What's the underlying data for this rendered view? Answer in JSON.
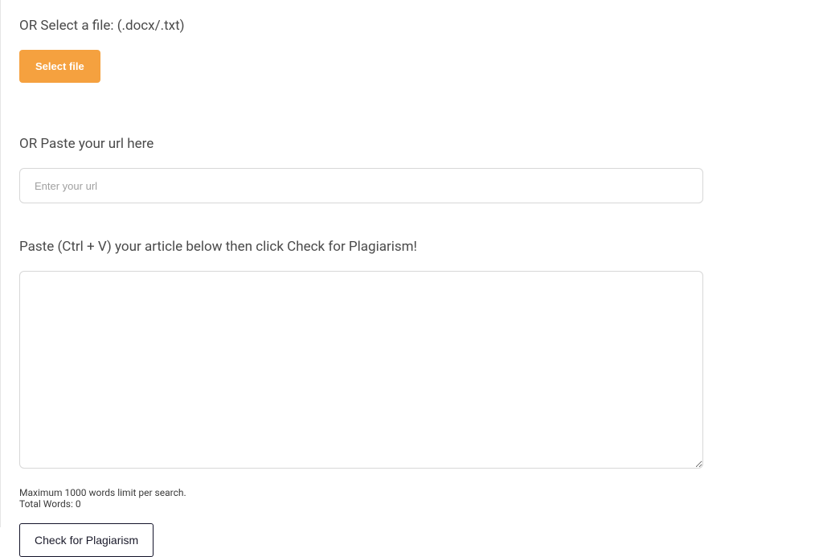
{
  "file_section": {
    "label": "OR Select a file: (.docx/.txt)",
    "button_label": "Select file"
  },
  "url_section": {
    "label": "OR Paste your url here",
    "placeholder": "Enter your url"
  },
  "article_section": {
    "label": "Paste (Ctrl + V) your article below then click Check for Plagiarism!",
    "limit_text": "Maximum 1000 words limit per search.",
    "word_count_label": "Total Words: ",
    "word_count": "0",
    "check_button_label": "Check for Plagiarism"
  }
}
